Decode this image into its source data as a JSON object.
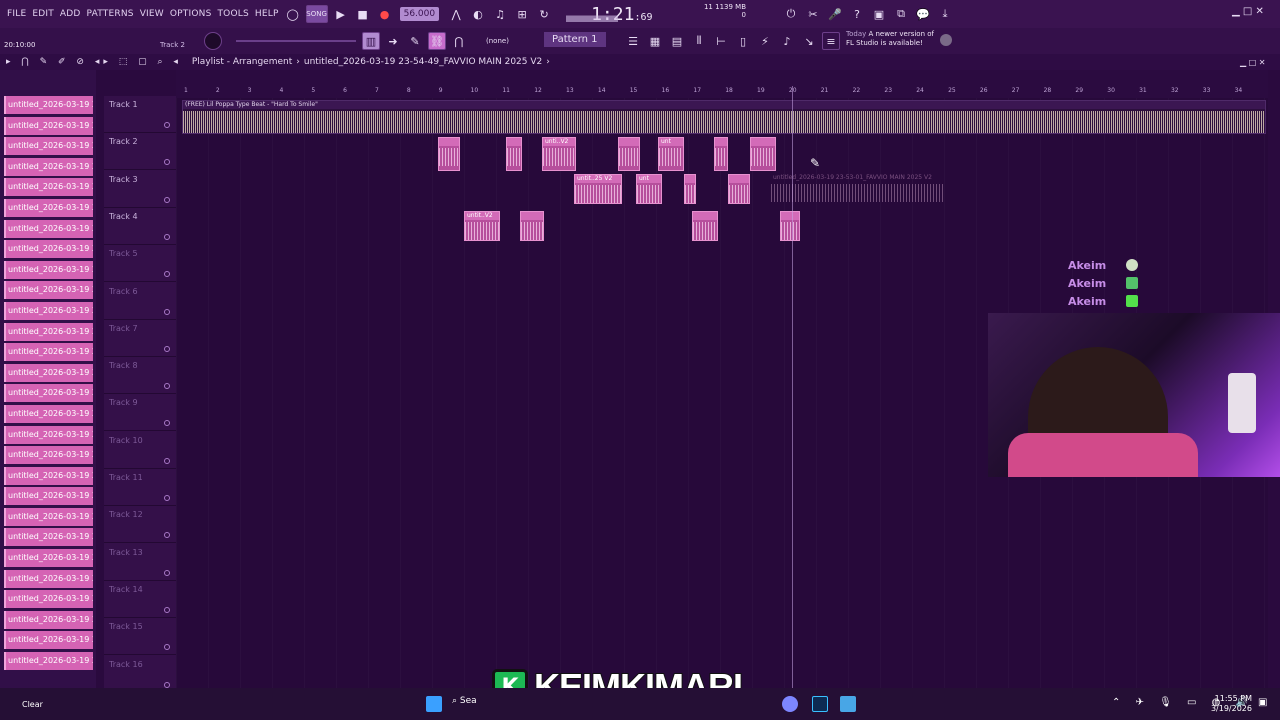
{
  "menu": {
    "items": [
      "FILE",
      "EDIT",
      "ADD",
      "PATTERNS",
      "VIEW",
      "OPTIONS",
      "TOOLS",
      "HELP"
    ]
  },
  "transport": {
    "tempo": "56.000",
    "song_time": "1:21",
    "song_time_sub": ":69",
    "cpu": "11",
    "memory": "1139 MB",
    "memory_sub": "0"
  },
  "toolbar2": {
    "hint_time": "20:10:00",
    "hint_track": "Track 2",
    "snap": "(none)",
    "pattern": "Pattern 1",
    "news_title": "Today",
    "news_text": "A newer version of FL Studio is available!"
  },
  "playlist": {
    "title": "Playlist - Arrangement",
    "project": "untitled_2026-03-19 23-54-49_FAVVIO MAIN 2025 V2",
    "ruler": [
      "1",
      "2",
      "3",
      "4",
      "5",
      "6",
      "7",
      "8",
      "9",
      "10",
      "11",
      "12",
      "13",
      "14",
      "15",
      "16",
      "17",
      "18",
      "19",
      "20",
      "21",
      "22",
      "23",
      "24",
      "25",
      "26",
      "27",
      "28",
      "29",
      "30",
      "31",
      "32",
      "33",
      "34"
    ]
  },
  "browser": {
    "item_label": "untitled_2026-03-19 23-..."
  },
  "tracks": [
    {
      "name": "Track 1"
    },
    {
      "name": "Track 2"
    },
    {
      "name": "Track 3"
    },
    {
      "name": "Track 4"
    },
    {
      "name": "Track 5"
    },
    {
      "name": "Track 6"
    },
    {
      "name": "Track 7"
    },
    {
      "name": "Track 8"
    },
    {
      "name": "Track 9"
    },
    {
      "name": "Track 10"
    },
    {
      "name": "Track 11"
    },
    {
      "name": "Track 12"
    },
    {
      "name": "Track 13"
    },
    {
      "name": "Track 14"
    },
    {
      "name": "Track 15"
    },
    {
      "name": "Track 16"
    }
  ],
  "clips": {
    "main": "(FREE) Lil Poppa Type Beat - \"Hard To Smile\"",
    "c1": "untit..25 V2",
    "c2": "unti..V2",
    "c3": "unt",
    "c4": "untit..V2",
    "c5": "unt",
    "ghost": "untitled_2026-03-19 23-53-01_FAVVIO MAIN 2025 V2"
  },
  "overlay": {
    "names": [
      "Akeim",
      "Akeim",
      "Akeim"
    ]
  },
  "brand": {
    "letter": "K",
    "text": "KEIMKIMARI"
  },
  "taskbar": {
    "search": "Sea",
    "time": "11:55 PM",
    "date": "3/19/2026",
    "weather": "Clear"
  },
  "colors": {
    "accent": "#d563b4",
    "background": "#27093a",
    "brand_green": "#1db954"
  }
}
